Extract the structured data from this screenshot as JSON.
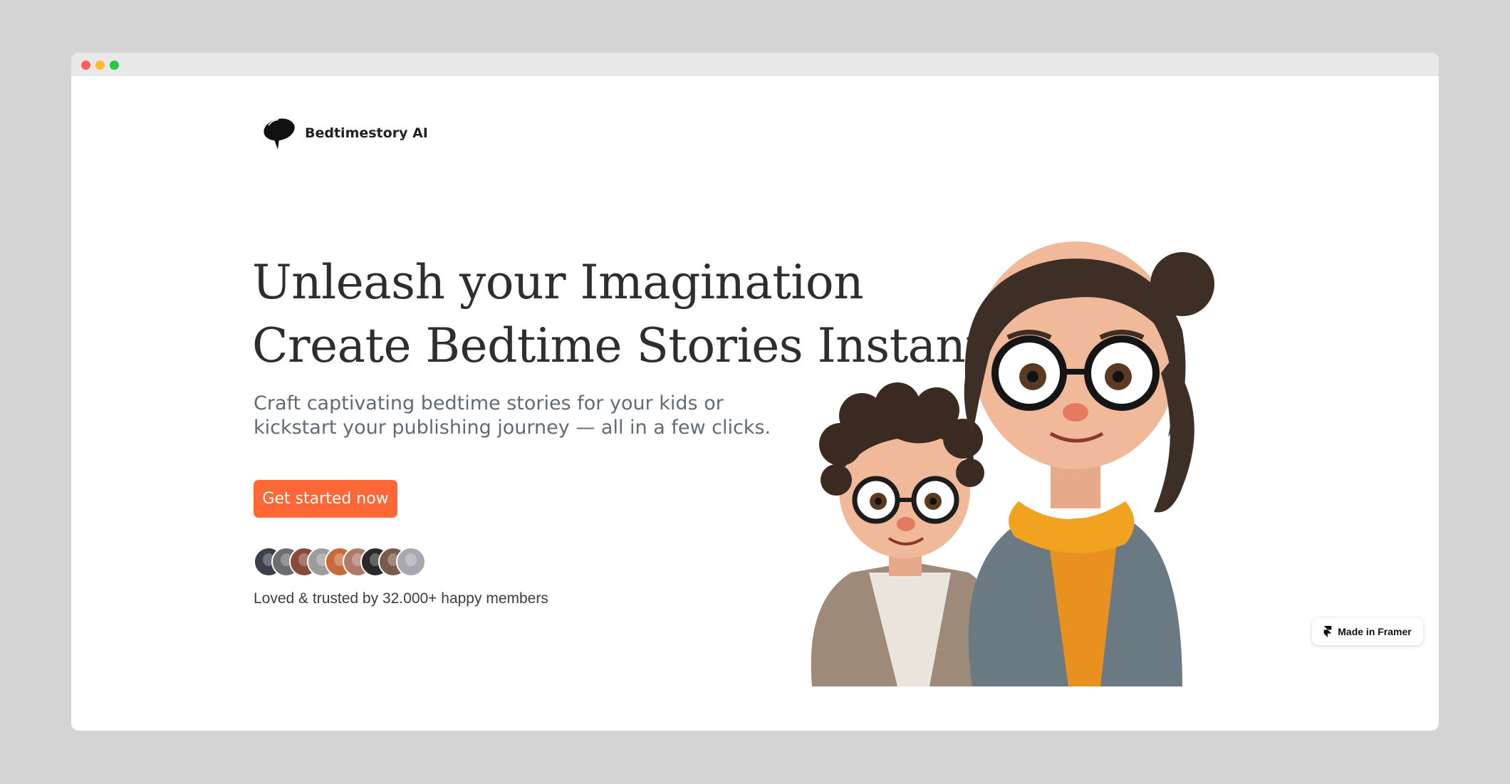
{
  "brand": {
    "name": "Bedtimestory AI"
  },
  "hero": {
    "headline_line1": "Unleash your Imagination",
    "headline_line2": "Create Bedtime Stories Instantly",
    "subtitle_line1": "Craft captivating bedtime stories for your kids or",
    "subtitle_line2": "kickstart your publishing journey — all in a few clicks.",
    "cta_label": "Get started now",
    "trust_text": "Loved & trusted by 32.000+ happy members"
  },
  "avatars": [
    {
      "color": "#3a3f4a"
    },
    {
      "color": "#6b6d70"
    },
    {
      "color": "#8a4a3a"
    },
    {
      "color": "#9c9c9c"
    },
    {
      "color": "#c86a3a"
    },
    {
      "color": "#b07a6a"
    },
    {
      "color": "#2a2a2a"
    },
    {
      "color": "#7a5a4a"
    },
    {
      "color": "#a8a8b0"
    }
  ],
  "badge": {
    "label": "Made in Framer"
  },
  "colors": {
    "accent": "#ff6737",
    "headline": "#2e2e2e",
    "subtitle": "#5f6b76"
  }
}
